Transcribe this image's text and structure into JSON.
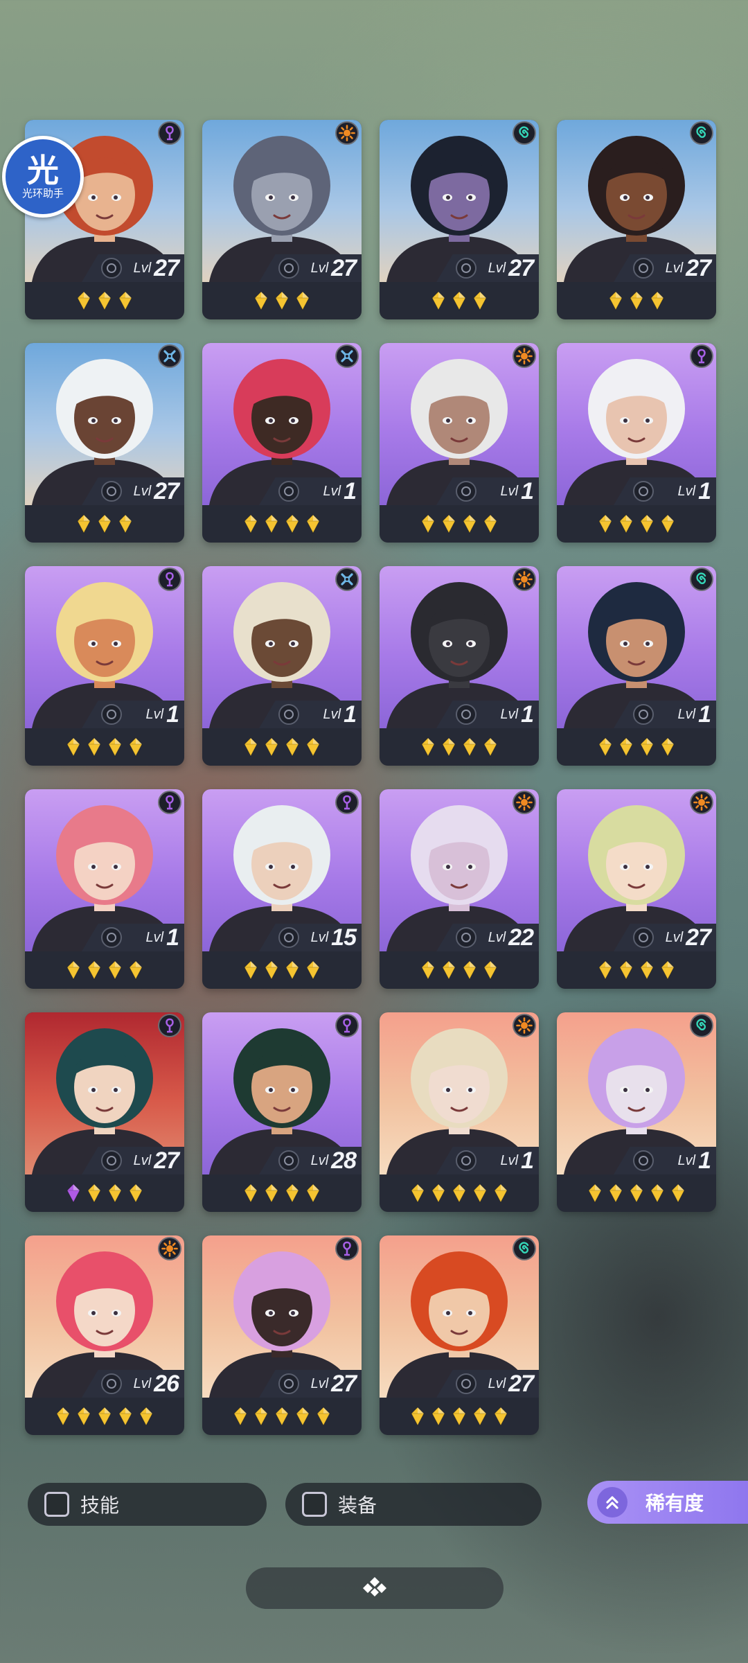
{
  "watermark": {
    "glyph": "光",
    "text": "光环助手"
  },
  "level_label": "Lvl",
  "colors": {
    "faction": {
      "purple": "#a760e6",
      "orange": "#f08a22",
      "teal": "#35d6b8",
      "blue": "#6fb8e8"
    },
    "star_gold": "#f5c431",
    "star_purple": "#b05be6",
    "card_bg": "#262a36",
    "rarity_button": "#9a82f2"
  },
  "heroes": [
    {
      "level": "27",
      "faction": "purple",
      "stars": [
        "gold",
        "gold",
        "gold"
      ],
      "bg": "sky",
      "hair": "#c24b2e",
      "skin": "#e8b38f"
    },
    {
      "level": "27",
      "faction": "orange",
      "stars": [
        "gold",
        "gold",
        "gold"
      ],
      "bg": "sky",
      "hair": "#5e6478",
      "skin": "#9aa0b0"
    },
    {
      "level": "27",
      "faction": "teal",
      "stars": [
        "gold",
        "gold",
        "gold"
      ],
      "bg": "sky",
      "hair": "#1c2230",
      "skin": "#7d6aa0"
    },
    {
      "level": "27",
      "faction": "teal",
      "stars": [
        "gold",
        "gold",
        "gold"
      ],
      "bg": "sky",
      "hair": "#2a1e1e",
      "skin": "#7a4a32"
    },
    {
      "level": "27",
      "faction": "blue",
      "stars": [
        "gold",
        "gold",
        "gold"
      ],
      "bg": "sky",
      "hair": "#eef2f4",
      "skin": "#6a4434"
    },
    {
      "level": "1",
      "faction": "blue",
      "stars": [
        "gold",
        "gold",
        "gold",
        "gold"
      ],
      "bg": "purple",
      "hair": "#d83c5a",
      "skin": "#3e2a24"
    },
    {
      "level": "1",
      "faction": "orange",
      "stars": [
        "gold",
        "gold",
        "gold",
        "gold"
      ],
      "bg": "purple",
      "hair": "#e8e8e8",
      "skin": "#b08878"
    },
    {
      "level": "1",
      "faction": "purple",
      "stars": [
        "gold",
        "gold",
        "gold",
        "gold"
      ],
      "bg": "purple",
      "hair": "#f0f0f4",
      "skin": "#e8c4b0"
    },
    {
      "level": "1",
      "faction": "purple",
      "stars": [
        "gold",
        "gold",
        "gold",
        "gold"
      ],
      "bg": "purple",
      "hair": "#f0d890",
      "skin": "#d98a5a"
    },
    {
      "level": "1",
      "faction": "blue",
      "stars": [
        "gold",
        "gold",
        "gold",
        "gold"
      ],
      "bg": "purple",
      "hair": "#e8e0cc",
      "skin": "#6b4a36"
    },
    {
      "level": "1",
      "faction": "orange",
      "stars": [
        "gold",
        "gold",
        "gold",
        "gold"
      ],
      "bg": "purple",
      "hair": "#2a2a30",
      "skin": "#3a3a40"
    },
    {
      "level": "1",
      "faction": "teal",
      "stars": [
        "gold",
        "gold",
        "gold",
        "gold"
      ],
      "bg": "purple",
      "hair": "#1e2a40",
      "skin": "#c89070"
    },
    {
      "level": "1",
      "faction": "purple",
      "stars": [
        "gold",
        "gold",
        "gold",
        "gold"
      ],
      "bg": "purple",
      "hair": "#e87a8a",
      "skin": "#f4d2c4"
    },
    {
      "level": "15",
      "faction": "purple",
      "stars": [
        "gold",
        "gold",
        "gold",
        "gold"
      ],
      "bg": "purple",
      "hair": "#e9eef0",
      "skin": "#ecd0bc"
    },
    {
      "level": "22",
      "faction": "orange",
      "stars": [
        "gold",
        "gold",
        "gold",
        "gold"
      ],
      "bg": "purple",
      "hair": "#e6dcef",
      "skin": "#d8c0d8"
    },
    {
      "level": "27",
      "faction": "orange",
      "stars": [
        "gold",
        "gold",
        "gold",
        "gold"
      ],
      "bg": "purple",
      "hair": "#d8dca0",
      "skin": "#f4dcc8"
    },
    {
      "level": "27",
      "faction": "purple",
      "stars": [
        "purple",
        "gold",
        "gold",
        "gold"
      ],
      "bg": "red",
      "hair": "#1e4a4e",
      "skin": "#f0d4c0"
    },
    {
      "level": "28",
      "faction": "purple",
      "stars": [
        "gold",
        "gold",
        "gold",
        "gold"
      ],
      "bg": "purple",
      "hair": "#1e3a32",
      "skin": "#d8a480"
    },
    {
      "level": "1",
      "faction": "orange",
      "stars": [
        "gold",
        "gold",
        "gold",
        "gold",
        "gold"
      ],
      "bg": "sunset",
      "hair": "#e8dcc0",
      "skin": "#f0dcd0"
    },
    {
      "level": "1",
      "faction": "teal",
      "stars": [
        "gold",
        "gold",
        "gold",
        "gold",
        "gold"
      ],
      "bg": "sunset",
      "hair": "#c8a0e8",
      "skin": "#e8e0ec"
    },
    {
      "level": "26",
      "faction": "orange",
      "stars": [
        "gold",
        "gold",
        "gold",
        "gold",
        "gold"
      ],
      "bg": "sunset",
      "hair": "#e8506a",
      "skin": "#f4d8c8"
    },
    {
      "level": "27",
      "faction": "purple",
      "stars": [
        "gold",
        "gold",
        "gold",
        "gold",
        "gold"
      ],
      "bg": "sunset",
      "hair": "#d8a0e0",
      "skin": "#3a2a2a"
    },
    {
      "level": "27",
      "faction": "teal",
      "stars": [
        "gold",
        "gold",
        "gold",
        "gold",
        "gold"
      ],
      "bg": "sunset",
      "hair": "#d84a22",
      "skin": "#f0c8a8"
    }
  ],
  "filters": {
    "skill_label": "技能",
    "equipment_label": "装备"
  },
  "sort": {
    "rarity_label": "稀有度"
  },
  "bottom_bar": {
    "icon": "diamond-cluster-icon"
  }
}
